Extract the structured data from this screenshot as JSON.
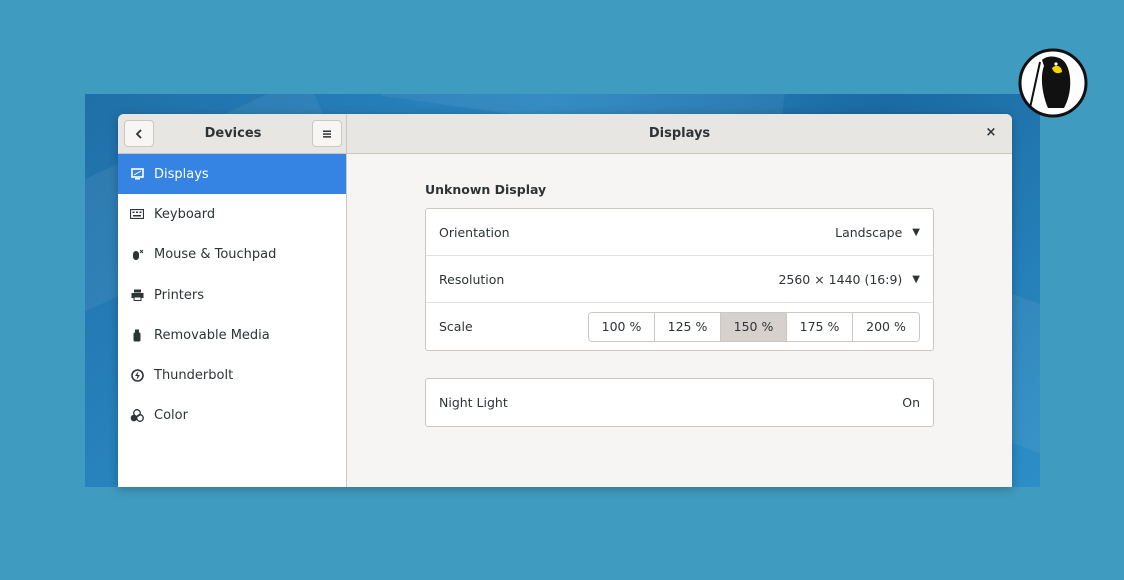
{
  "window": {
    "sidebar_title": "Devices",
    "main_title": "Displays",
    "back_icon": "back-icon",
    "menu_icon": "hamburger-menu-icon",
    "close_glyph": "×"
  },
  "sidebar": {
    "items": [
      {
        "label": "Displays",
        "icon": "display-icon",
        "active": true
      },
      {
        "label": "Keyboard",
        "icon": "keyboard-icon",
        "active": false
      },
      {
        "label": "Mouse & Touchpad",
        "icon": "mouse-icon",
        "active": false
      },
      {
        "label": "Printers",
        "icon": "printer-icon",
        "active": false
      },
      {
        "label": "Removable Media",
        "icon": "usb-icon",
        "active": false
      },
      {
        "label": "Thunderbolt",
        "icon": "thunderbolt-icon",
        "active": false
      },
      {
        "label": "Color",
        "icon": "color-icon",
        "active": false
      }
    ]
  },
  "display": {
    "section_title": "Unknown Display",
    "orientation": {
      "label": "Orientation",
      "value": "Landscape"
    },
    "resolution": {
      "label": "Resolution",
      "value": "2560 × 1440 (16:9)"
    },
    "scale": {
      "label": "Scale",
      "options": [
        "100 %",
        "125 %",
        "150 %",
        "175 %",
        "200 %"
      ],
      "selected": "150 %"
    }
  },
  "night_light": {
    "label": "Night Light",
    "value": "On"
  },
  "colors": {
    "background": "#3f9bc0",
    "accent": "#3584e4",
    "headerbar": "#e8e6e3"
  }
}
